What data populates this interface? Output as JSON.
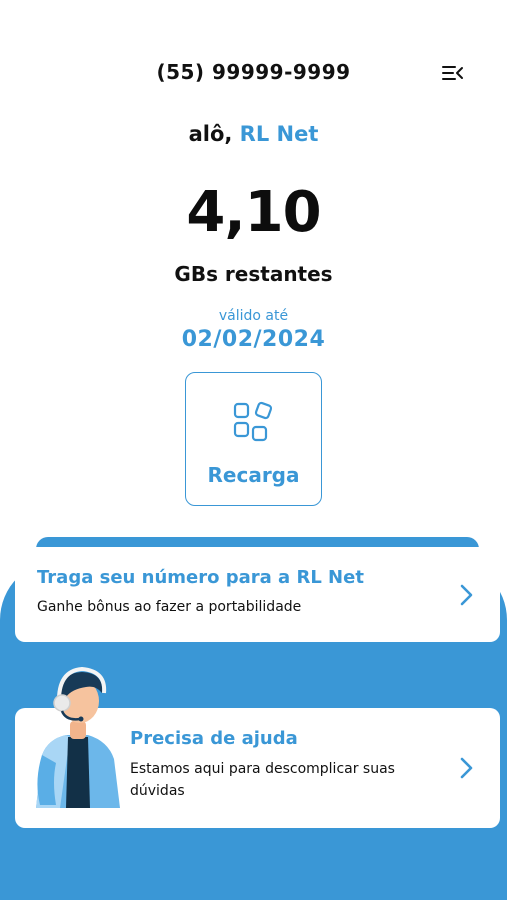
{
  "header": {
    "phone_number": "(55) 99999-9999",
    "menu_icon": "menu-collapse-icon"
  },
  "greeting": {
    "prefix": "alô,",
    "name": "RL Net"
  },
  "balance": {
    "value": "4,10",
    "unit": "GBs restantes",
    "valid_label": "válido até",
    "valid_date": "02/02/2024"
  },
  "recharge": {
    "label": "Recarga",
    "icon": "apps-grid-icon"
  },
  "portability_card": {
    "title": "Traga seu número para a  RL Net",
    "subtitle": "Ganhe bônus ao fazer a portabilidade",
    "icon": "chevron-right-icon"
  },
  "help_card": {
    "title": "Precisa de ajuda",
    "subtitle": "Estamos aqui para descomplicar suas dúvidas",
    "icon": "chevron-right-icon",
    "illustration": "support-agent-illustration"
  },
  "colors": {
    "accent": "#3a97d6",
    "text": "#111111",
    "background": "#ffffff"
  }
}
